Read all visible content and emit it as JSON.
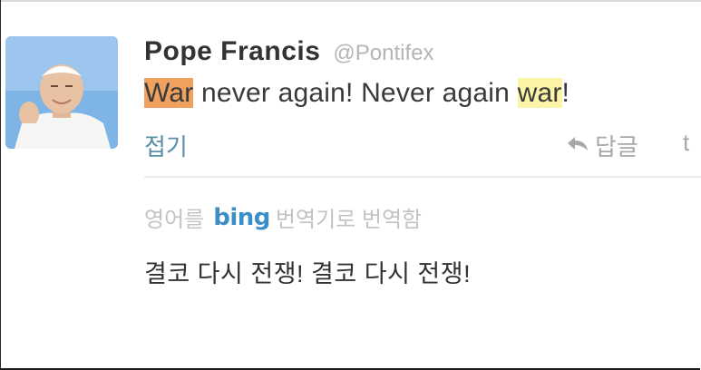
{
  "tweet": {
    "author_name": "Pope Francis",
    "handle": "@Pontifex",
    "text_parts": [
      "War",
      " never again! Never again ",
      "war",
      "!"
    ],
    "highlight_colors": {
      "first": "#f0a15f",
      "second": "#fcf4a6"
    },
    "avatar_icon": "avatar-portrait"
  },
  "actions": {
    "collapse_label": "접기",
    "reply_label": "답글",
    "reply_icon": "reply-arrow-icon",
    "retweet_edge": "t"
  },
  "translation": {
    "prefix": "영어를",
    "brand": "bing",
    "suffix": "번역기로 번역함",
    "text": "결코 다시 전쟁! 결코 다시 전쟁!",
    "brand_color": "#3b8fc6"
  }
}
